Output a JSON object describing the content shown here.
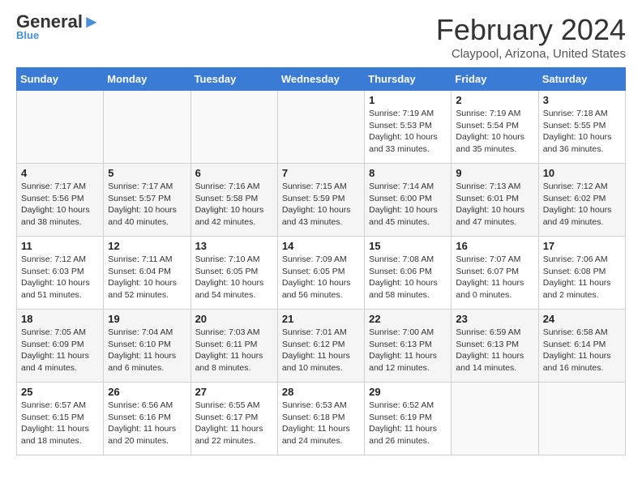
{
  "logo": {
    "part1": "General",
    "part2": "Blue"
  },
  "title": "February 2024",
  "location": "Claypool, Arizona, United States",
  "days_of_week": [
    "Sunday",
    "Monday",
    "Tuesday",
    "Wednesday",
    "Thursday",
    "Friday",
    "Saturday"
  ],
  "weeks": [
    [
      {
        "day": "",
        "content": ""
      },
      {
        "day": "",
        "content": ""
      },
      {
        "day": "",
        "content": ""
      },
      {
        "day": "",
        "content": ""
      },
      {
        "day": "1",
        "content": "Sunrise: 7:19 AM\nSunset: 5:53 PM\nDaylight: 10 hours\nand 33 minutes."
      },
      {
        "day": "2",
        "content": "Sunrise: 7:19 AM\nSunset: 5:54 PM\nDaylight: 10 hours\nand 35 minutes."
      },
      {
        "day": "3",
        "content": "Sunrise: 7:18 AM\nSunset: 5:55 PM\nDaylight: 10 hours\nand 36 minutes."
      }
    ],
    [
      {
        "day": "4",
        "content": "Sunrise: 7:17 AM\nSunset: 5:56 PM\nDaylight: 10 hours\nand 38 minutes."
      },
      {
        "day": "5",
        "content": "Sunrise: 7:17 AM\nSunset: 5:57 PM\nDaylight: 10 hours\nand 40 minutes."
      },
      {
        "day": "6",
        "content": "Sunrise: 7:16 AM\nSunset: 5:58 PM\nDaylight: 10 hours\nand 42 minutes."
      },
      {
        "day": "7",
        "content": "Sunrise: 7:15 AM\nSunset: 5:59 PM\nDaylight: 10 hours\nand 43 minutes."
      },
      {
        "day": "8",
        "content": "Sunrise: 7:14 AM\nSunset: 6:00 PM\nDaylight: 10 hours\nand 45 minutes."
      },
      {
        "day": "9",
        "content": "Sunrise: 7:13 AM\nSunset: 6:01 PM\nDaylight: 10 hours\nand 47 minutes."
      },
      {
        "day": "10",
        "content": "Sunrise: 7:12 AM\nSunset: 6:02 PM\nDaylight: 10 hours\nand 49 minutes."
      }
    ],
    [
      {
        "day": "11",
        "content": "Sunrise: 7:12 AM\nSunset: 6:03 PM\nDaylight: 10 hours\nand 51 minutes."
      },
      {
        "day": "12",
        "content": "Sunrise: 7:11 AM\nSunset: 6:04 PM\nDaylight: 10 hours\nand 52 minutes."
      },
      {
        "day": "13",
        "content": "Sunrise: 7:10 AM\nSunset: 6:05 PM\nDaylight: 10 hours\nand 54 minutes."
      },
      {
        "day": "14",
        "content": "Sunrise: 7:09 AM\nSunset: 6:05 PM\nDaylight: 10 hours\nand 56 minutes."
      },
      {
        "day": "15",
        "content": "Sunrise: 7:08 AM\nSunset: 6:06 PM\nDaylight: 10 hours\nand 58 minutes."
      },
      {
        "day": "16",
        "content": "Sunrise: 7:07 AM\nSunset: 6:07 PM\nDaylight: 11 hours\nand 0 minutes."
      },
      {
        "day": "17",
        "content": "Sunrise: 7:06 AM\nSunset: 6:08 PM\nDaylight: 11 hours\nand 2 minutes."
      }
    ],
    [
      {
        "day": "18",
        "content": "Sunrise: 7:05 AM\nSunset: 6:09 PM\nDaylight: 11 hours\nand 4 minutes."
      },
      {
        "day": "19",
        "content": "Sunrise: 7:04 AM\nSunset: 6:10 PM\nDaylight: 11 hours\nand 6 minutes."
      },
      {
        "day": "20",
        "content": "Sunrise: 7:03 AM\nSunset: 6:11 PM\nDaylight: 11 hours\nand 8 minutes."
      },
      {
        "day": "21",
        "content": "Sunrise: 7:01 AM\nSunset: 6:12 PM\nDaylight: 11 hours\nand 10 minutes."
      },
      {
        "day": "22",
        "content": "Sunrise: 7:00 AM\nSunset: 6:13 PM\nDaylight: 11 hours\nand 12 minutes."
      },
      {
        "day": "23",
        "content": "Sunrise: 6:59 AM\nSunset: 6:13 PM\nDaylight: 11 hours\nand 14 minutes."
      },
      {
        "day": "24",
        "content": "Sunrise: 6:58 AM\nSunset: 6:14 PM\nDaylight: 11 hours\nand 16 minutes."
      }
    ],
    [
      {
        "day": "25",
        "content": "Sunrise: 6:57 AM\nSunset: 6:15 PM\nDaylight: 11 hours\nand 18 minutes."
      },
      {
        "day": "26",
        "content": "Sunrise: 6:56 AM\nSunset: 6:16 PM\nDaylight: 11 hours\nand 20 minutes."
      },
      {
        "day": "27",
        "content": "Sunrise: 6:55 AM\nSunset: 6:17 PM\nDaylight: 11 hours\nand 22 minutes."
      },
      {
        "day": "28",
        "content": "Sunrise: 6:53 AM\nSunset: 6:18 PM\nDaylight: 11 hours\nand 24 minutes."
      },
      {
        "day": "29",
        "content": "Sunrise: 6:52 AM\nSunset: 6:19 PM\nDaylight: 11 hours\nand 26 minutes."
      },
      {
        "day": "",
        "content": ""
      },
      {
        "day": "",
        "content": ""
      }
    ]
  ]
}
